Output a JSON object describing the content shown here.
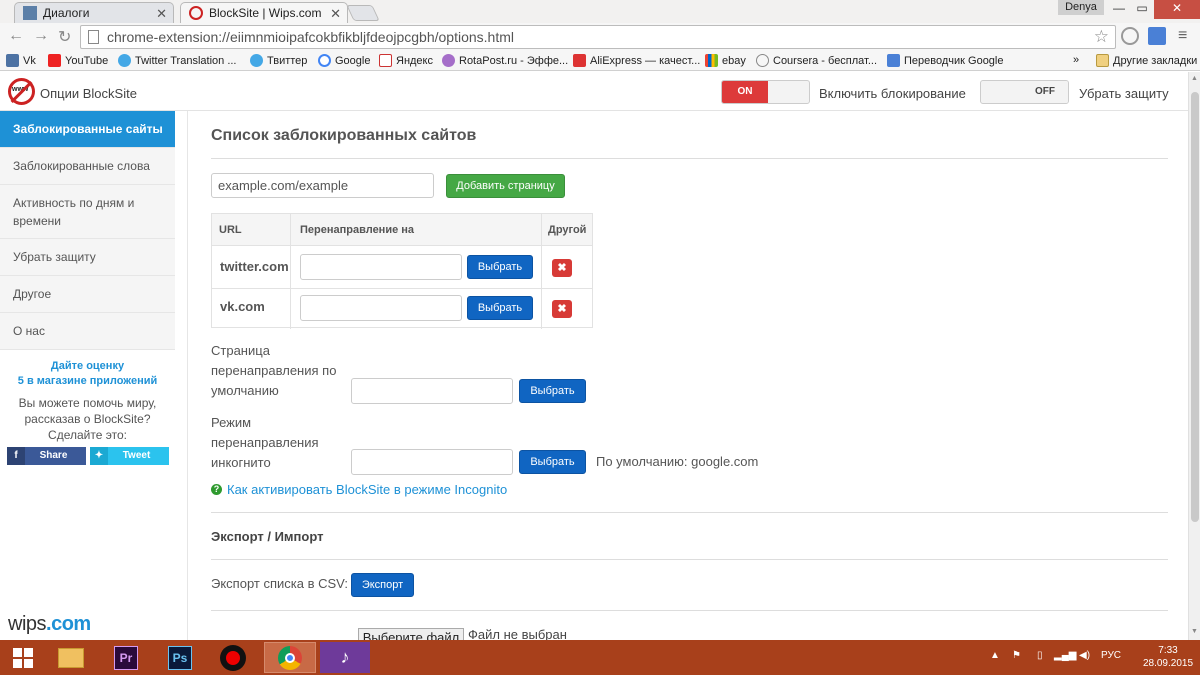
{
  "browser": {
    "tabs": [
      {
        "title": "Диалоги"
      },
      {
        "title": "BlockSite | Wips.com"
      }
    ],
    "user": "Denya",
    "url": "chrome-extension://eiimnmioipafcokbfikbljfdeojpcgbh/options.html",
    "bookmarks": [
      {
        "label": "Vk",
        "icon": "vk-icon"
      },
      {
        "label": "YouTube",
        "icon": "youtube-icon"
      },
      {
        "label": "Twitter Translation ...",
        "icon": "twitter-icon"
      },
      {
        "label": "Твиттер",
        "icon": "twitter-icon"
      },
      {
        "label": "Google",
        "icon": "google-icon"
      },
      {
        "label": "Яндекс",
        "icon": "yandex-icon"
      },
      {
        "label": "RotaPost.ru - Эффе...",
        "icon": "rotapost-icon"
      },
      {
        "label": "AliExpress — качест...",
        "icon": "aliexpress-icon"
      },
      {
        "label": "ebay",
        "icon": "ebay-icon"
      },
      {
        "label": "Coursera - бесплат...",
        "icon": "coursera-icon"
      },
      {
        "label": "Переводчик Google",
        "icon": "google-translate-icon"
      }
    ],
    "bookmarks_overflow": "»",
    "other_bookmarks": "Другие закладки"
  },
  "header": {
    "brand": "Опции BlockSite",
    "toggle1_on": "ON",
    "toggle1_label": "Включить блокирование",
    "toggle2_off": "OFF",
    "toggle2_label": "Убрать защиту"
  },
  "sidebar": {
    "items": [
      {
        "label": "Заблокированные сайты"
      },
      {
        "label": "Заблокированные слова"
      },
      {
        "label": "Активность по дням и времени"
      },
      {
        "label": "Убрать защиту"
      },
      {
        "label": "Другое"
      },
      {
        "label": "О нас"
      }
    ],
    "rate_line1": "Дайте оценку",
    "rate_line2": "5 в магазине приложений",
    "help_text": "Вы можете помочь миру, рассказав о BlockSite? Сделайте это:",
    "share_label": "Share",
    "tweet_label": "Tweet",
    "wips_a": "wips",
    "wips_b": ".com"
  },
  "main": {
    "title": "Список заблокированных сайтов",
    "add_input_value": "example.com/example",
    "add_button": "Добавить страницу",
    "table": {
      "headers": [
        "URL",
        "Перенаправление на",
        "Другой"
      ],
      "rows": [
        {
          "url": "twitter.com",
          "select": "Выбрать"
        },
        {
          "url": "vk.com",
          "select": "Выбрать"
        }
      ]
    },
    "default_redirect_label": "Страница перенаправления по умолчанию",
    "default_redirect_button": "Выбрать",
    "incognito_label": "Режим перенаправления инкогнито",
    "incognito_button": "Выбрать",
    "incognito_default": "По умолчанию: google.com",
    "incognito_link": "Как активировать BlockSite в режиме Incognito",
    "export_import_title": "Экспорт / Импорт",
    "export_label": "Экспорт списка в CSV:",
    "export_button": "Экспорт",
    "file_button": "Выберите файл",
    "file_none": "Файл не выбран"
  },
  "taskbar": {
    "lang": "РУС",
    "time": "7:33",
    "date": "28.09.2015"
  }
}
